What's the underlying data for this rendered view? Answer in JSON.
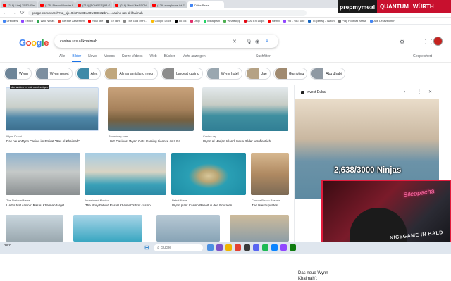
{
  "browser": {
    "tabs": [
      {
        "label": "(216) Live] 25/12: Ein outer",
        "color": "#ff0000"
      },
      {
        "label": "(125) Ebeno Wonder Plate Vor",
        "color": "#ff0000"
      },
      {
        "label": "(216) [BOHRER] 93 Grill Xxx",
        "color": "#ff0000"
      },
      {
        "label": "(216) Wirst WaSSON mark",
        "color": "#ff0000"
      },
      {
        "label": "(129) sofaplenne ist Ein",
        "color": "#ff0000"
      },
      {
        "label": "Dritte Reise",
        "color": "#4285f4"
      }
    ],
    "url": "google.com/search?sa_sjx=9kbR8e8Eoa0w3EBs&tbn=...casino ras al khaimah",
    "bookmarks": [
      "Dreiviers",
      "Twitch",
      "Wiki Ninjas",
      "Gerade Abstreiten",
      "YouTube",
      "SVTBR",
      "The God of Hi...",
      "Google Docs",
      "TikTok",
      "Drop",
      "Instagram",
      "WhatsApp",
      "DATEV Login",
      "Netflix",
      "Vnl - YouTube",
      "TE prrrag - Twitch",
      "Play Football Arena",
      "Alle Lesezeichen"
    ]
  },
  "brand": {
    "left": "prepmymeal",
    "right1": "QUANTUM",
    "right2": "WÜRTH"
  },
  "search": {
    "logo": "Google",
    "query": "casino ras al khaimah",
    "tabs": [
      "Alle",
      "Bilder",
      "News",
      "Videos",
      "Kurze Videos",
      "Web",
      "Bücher",
      "Mehr anzeigen"
    ],
    "active_tab": "Bilder",
    "tools": "Suchfilter",
    "saved": "Gespeichert",
    "chips": [
      "Wynn",
      "Wynn resort",
      "Alec",
      "Al marjan island resort",
      "Largest casino",
      "Wynn hotel",
      "Uae",
      "Gambling",
      "Abu dhabi"
    ]
  },
  "results": [
    {
      "source": "Wynn Dubai",
      "caption": "Das neue Wynn Casino im Emirat \"Ras Al Khaimah\"",
      "badge": "die wollen es mir nicht zeigen"
    },
    {
      "source": "Boomberg.com",
      "caption": "UAE Casinos: Wynn Gets Gaming License as It Ba...",
      "badge": ""
    },
    {
      "source": "Casino.org",
      "caption": "Wynn Al Marjan Island, Neue Bilder veröffentlicht",
      "badge": ""
    },
    {
      "source": "The National News",
      "caption": "UAE's first casino: Ras Al Khaimah target",
      "badge": ""
    },
    {
      "source": "Investment Monitor",
      "caption": "The story behind Ras Al Khaimah's first casino",
      "badge": ""
    },
    {
      "source": "Petrol News",
      "caption": "Wynn plant Casino-Resort in den Emiraten",
      "badge": ""
    },
    {
      "source": "Connor Beach Resorts",
      "caption": "The latest updates",
      "badge": ""
    }
  ],
  "panel": {
    "source": "Invest Dubai",
    "title": "Das neue Wynn",
    "subtitle": "Khaimah\":"
  },
  "overlay": "2,638/3000 Ninjas",
  "cam": {
    "neon": "Sileopacha",
    "shirt": "NICEGAME IN BALD"
  },
  "taskbar": {
    "search": "Suche",
    "weather": "28°C"
  }
}
